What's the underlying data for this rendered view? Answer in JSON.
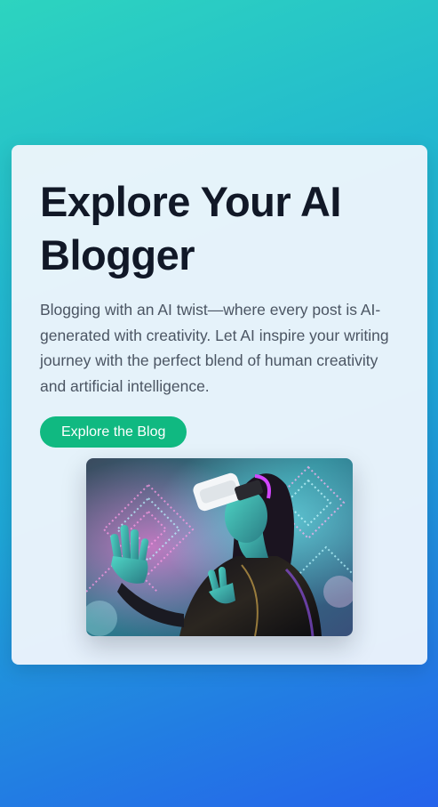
{
  "hero": {
    "title": "Explore Your AI Blogger",
    "description": "Blogging with an AI twist—where every post is AI-generated with creativity. Let AI inspire your writing journey with the perfect blend of human creativity and artificial intelligence.",
    "cta_label": "Explore the Blog",
    "image_subject": "person-wearing-vr-headset"
  },
  "colors": {
    "background_start": "#2dd4bf",
    "background_end": "#2563eb",
    "card": "#f0f6fc",
    "title": "#111827",
    "body_text": "#4b5563",
    "cta": "#10b981"
  }
}
